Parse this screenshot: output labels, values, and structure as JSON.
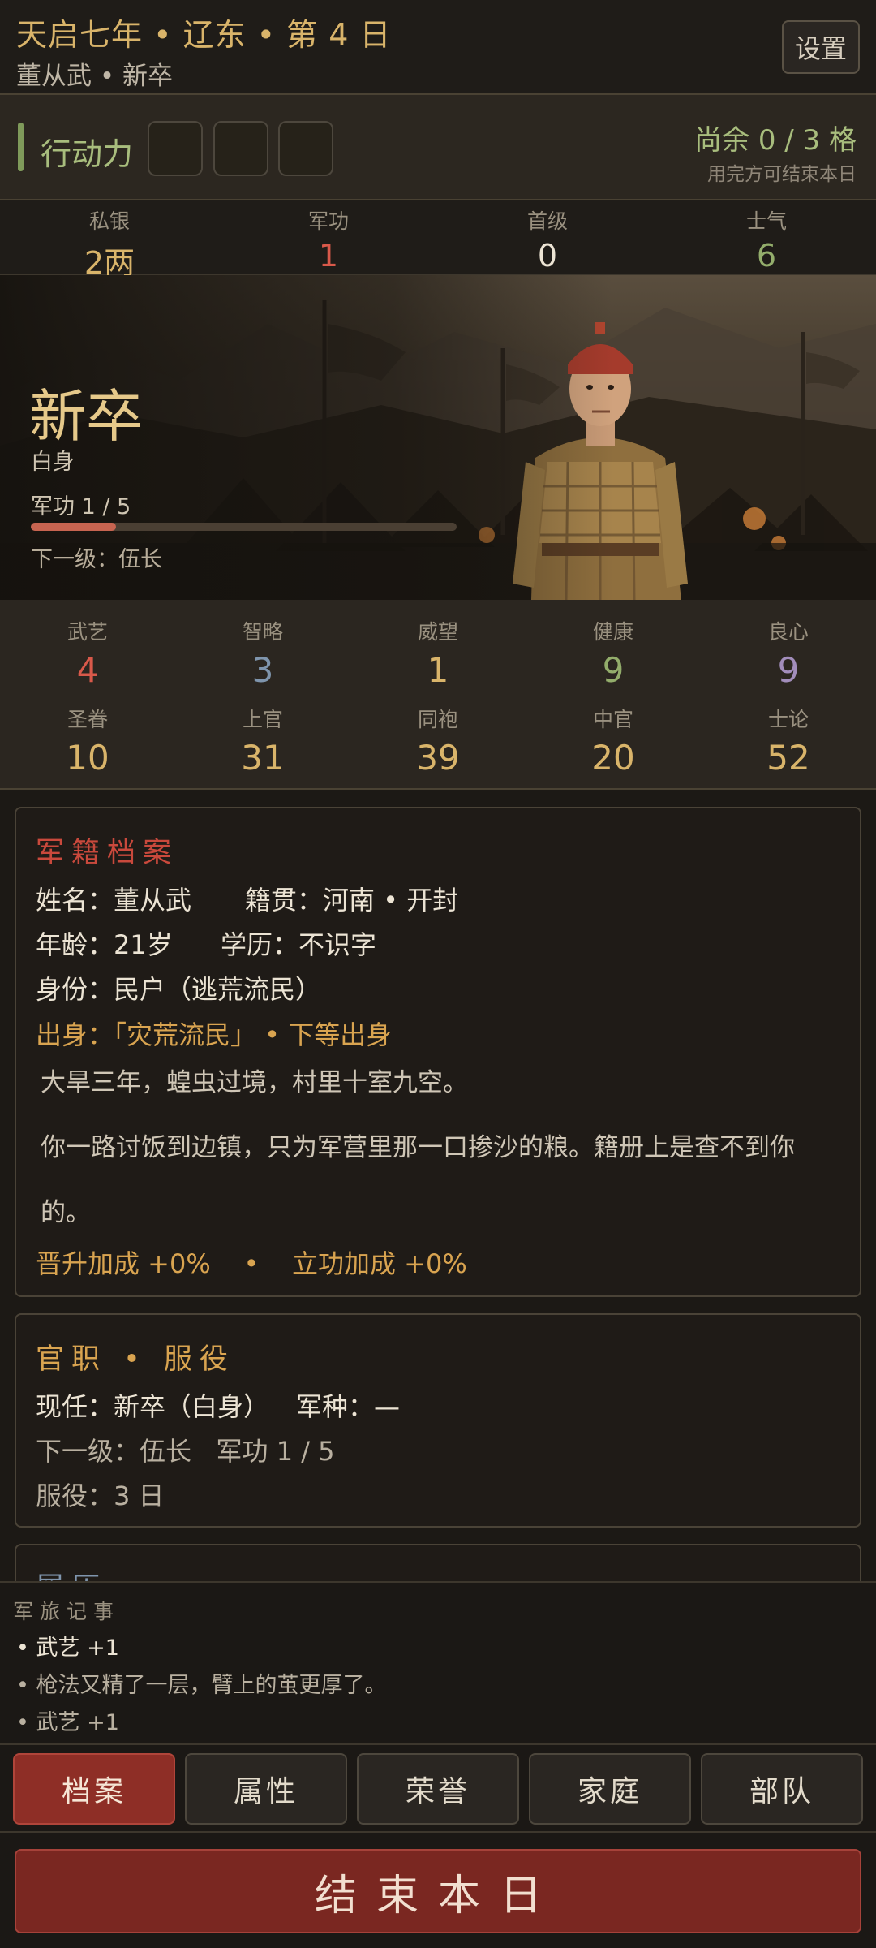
{
  "header": {
    "date": "天启七年 • 辽东 • 第 4 日",
    "who": "董从武 • 新卒",
    "settings_label": "设置"
  },
  "action": {
    "label": "行动力",
    "slots_total": 3,
    "slots_used": 0,
    "remain": "尚余 0 / 3 格",
    "note": "用完方可结束本日"
  },
  "resources": [
    {
      "label": "私银",
      "value": "2两",
      "color": "#d9b46a"
    },
    {
      "label": "军功",
      "value": "1",
      "color": "#d9594a"
    },
    {
      "label": "首级",
      "value": "0",
      "color": "#ece4d4"
    },
    {
      "label": "士气",
      "value": "6",
      "color": "#93ad6b"
    }
  ],
  "hero": {
    "rank": "新卒",
    "status": "白身",
    "merit": "军功 1 / 5",
    "merit_progress": 0.2,
    "next": "下一级：伍长"
  },
  "stats": [
    {
      "label": "武艺",
      "value": "4",
      "color": "#d9594a"
    },
    {
      "label": "智略",
      "value": "3",
      "color": "#7f95ad"
    },
    {
      "label": "威望",
      "value": "1",
      "color": "#d9b46a"
    },
    {
      "label": "健康",
      "value": "9",
      "color": "#93ad6b"
    },
    {
      "label": "良心",
      "value": "9",
      "color": "#a28dbb"
    },
    {
      "label": "圣眷",
      "value": "10",
      "color": "#d9b46a"
    },
    {
      "label": "上官",
      "value": "31",
      "color": "#d9b46a"
    },
    {
      "label": "同袍",
      "value": "39",
      "color": "#d9b46a"
    },
    {
      "label": "中官",
      "value": "20",
      "color": "#d9b46a"
    },
    {
      "label": "士论",
      "value": "52",
      "color": "#d9b46a"
    }
  ],
  "dossier": {
    "title": "军籍档案",
    "name": "姓名：董从武",
    "origin": "籍贯：河南 • 开封",
    "age": "年龄：21岁",
    "education": "学历：不识字",
    "identity": "身份：民户（逃荒流民）",
    "background": "出身：「灾荒流民」 • 下等出身",
    "story_1": "大旱三年，蝗虫过境，村里十室九空。",
    "story_2a": "你一路讨饭到边镇，只为军营里那一口掺沙的粮。籍册上是查不到你",
    "story_2b": "的。",
    "bonus": "晋升加成 +0%    •    立功加成 +0%"
  },
  "service": {
    "title": "官职 • 服役",
    "current": "现任：新卒（白身）",
    "branch": "军种：—",
    "next": "下一级：伍长   军功 1 / 5",
    "days": "服役：3 日"
  },
  "record": {
    "title": "履历"
  },
  "log": {
    "title": "军旅记事",
    "items": [
      {
        "text": "• 武艺 +1",
        "color": "#ece4d4"
      },
      {
        "text": "• 枪法又精了一层，臂上的茧更厚了。",
        "color": "#b9b0a0"
      },
      {
        "text": "• 武艺 +1",
        "color": "#b9b0a0"
      }
    ]
  },
  "tabs": [
    {
      "label": "档案",
      "active": true
    },
    {
      "label": "属性",
      "active": false
    },
    {
      "label": "荣誉",
      "active": false
    },
    {
      "label": "家庭",
      "active": false
    },
    {
      "label": "部队",
      "active": false
    }
  ],
  "end_day_label": "结束本日"
}
